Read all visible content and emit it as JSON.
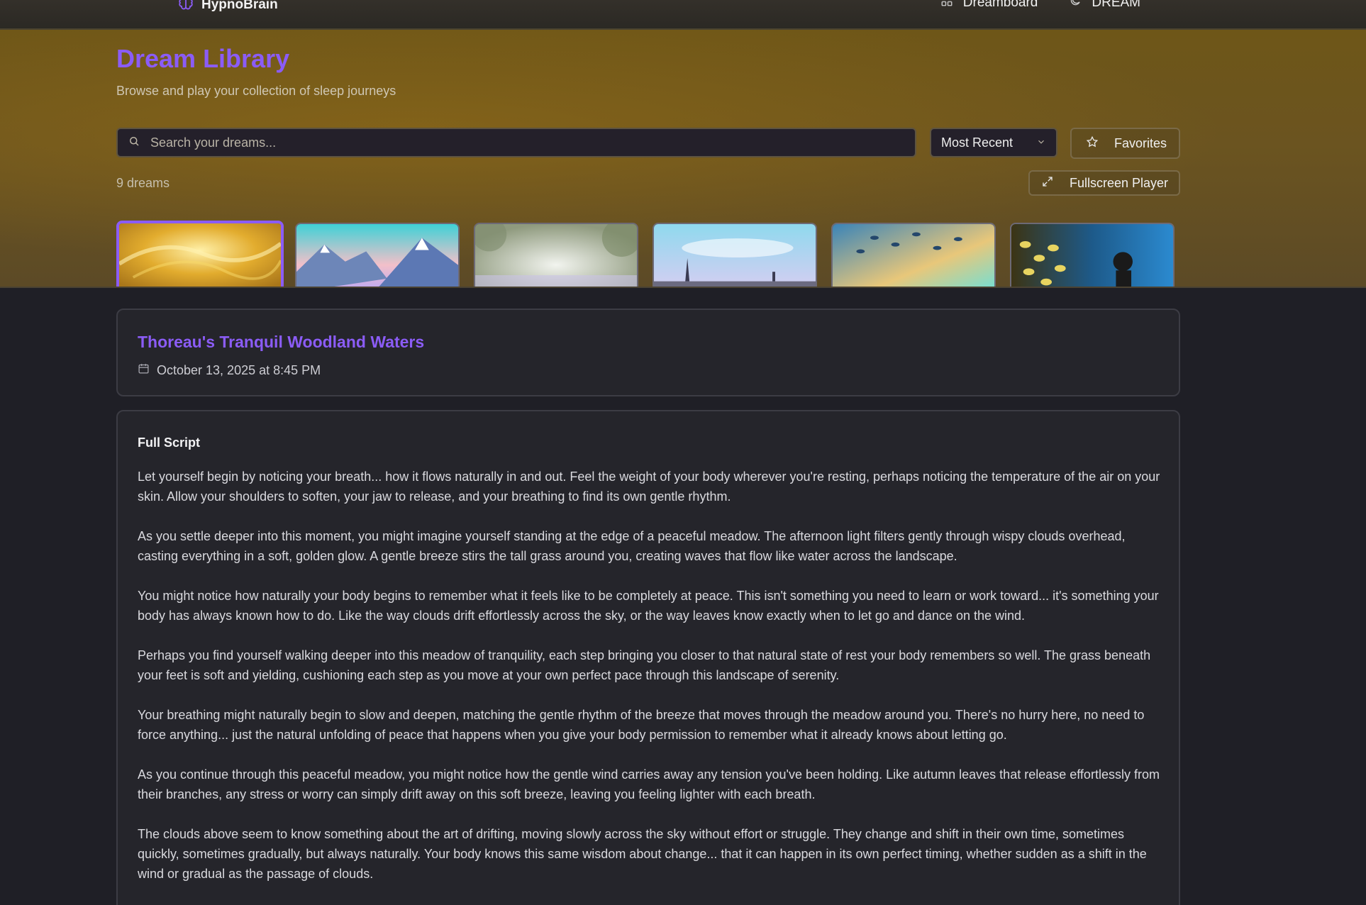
{
  "nav": {
    "brand": "HypnoBrain",
    "links": [
      {
        "label": "Dreamboard",
        "icon": "grid-icon"
      },
      {
        "label": "DREAM",
        "icon": "moon-icon"
      }
    ]
  },
  "header": {
    "title": "Dream Library",
    "subtitle": "Browse and play your collection of sleep journeys"
  },
  "toolbar": {
    "search_placeholder": "Search your dreams...",
    "sort_value": "Most Recent",
    "favorites_label": "Favorites",
    "count_label": "9 dreams",
    "fullscreen_label": "Fullscreen Player"
  },
  "thumbnails": [
    {
      "scene": "golden-sky",
      "selected": true
    },
    {
      "scene": "mountains",
      "selected": false
    },
    {
      "scene": "misty-forest",
      "selected": false
    },
    {
      "scene": "paris-skyline",
      "selected": false
    },
    {
      "scene": "fish-school",
      "selected": false
    },
    {
      "scene": "scuba-diver",
      "selected": false
    }
  ],
  "dream": {
    "title": "Thoreau's Tranquil Woodland Waters",
    "date": "October 13, 2025 at 8:45 PM"
  },
  "script": {
    "heading": "Full Script",
    "paragraphs": [
      "Let yourself begin by noticing your breath... how it flows naturally in and out. Feel the weight of your body wherever you're resting, perhaps noticing the temperature of the air on your skin. Allow your shoulders to soften, your jaw to release, and your breathing to find its own gentle rhythm.",
      "As you settle deeper into this moment, you might imagine yourself standing at the edge of a peaceful meadow. The afternoon light filters gently through wispy clouds overhead, casting everything in a soft, golden glow. A gentle breeze stirs the tall grass around you, creating waves that flow like water across the landscape.",
      "You might notice how naturally your body begins to remember what it feels like to be completely at peace. This isn't something you need to learn or work toward... it's something your body has always known how to do. Like the way clouds drift effortlessly across the sky, or the way leaves know exactly when to let go and dance on the wind.",
      "Perhaps you find yourself walking deeper into this meadow of tranquility, each step bringing you closer to that natural state of rest your body remembers so well. The grass beneath your feet is soft and yielding, cushioning each step as you move at your own perfect pace through this landscape of serenity.",
      "Your breathing might naturally begin to slow and deepen, matching the gentle rhythm of the breeze that moves through the meadow around you. There's no hurry here, no need to force anything... just the natural unfolding of peace that happens when you give your body permission to remember what it already knows about letting go.",
      "As you continue through this peaceful meadow, you might notice how the gentle wind carries away any tension you've been holding. Like autumn leaves that release effortlessly from their branches, any stress or worry can simply drift away on this soft breeze, leaving you feeling lighter with each breath.",
      "The clouds above seem to know something about the art of drifting, moving slowly across the sky without effort or struggle. They change and shift in their own time, sometimes quickly, sometimes gradually, but always naturally. Your body knows this same wisdom about change... that it can happen in its own perfect timing, whether sudden as a shift in the wind or gradual as the passage of clouds."
    ]
  },
  "colors": {
    "accent": "#8b5cf6",
    "hero_bg": "#6b5420",
    "card_bg": "#25252b",
    "page_bg": "#1f1f26"
  }
}
